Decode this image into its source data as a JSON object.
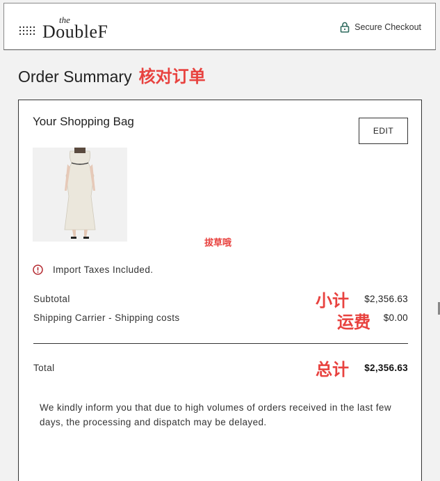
{
  "header": {
    "logo_small": "the",
    "logo_name": "DoubleF",
    "secure_label": "Secure Checkout"
  },
  "page": {
    "title": "Order Summary",
    "title_annotation": "核对订单"
  },
  "bag": {
    "title": "Your Shopping Bag",
    "edit_label": "EDIT",
    "center_annotation": "拔草哦",
    "taxes_notice": "Import Taxes Included.",
    "rows": [
      {
        "label": "Subtotal",
        "value": "$2,356.63",
        "annotation": "小计"
      },
      {
        "label": "Shipping Carrier - Shipping costs",
        "value": "$0.00",
        "annotation": "运费"
      }
    ],
    "total": {
      "label": "Total",
      "value": "$2,356.63",
      "annotation": "总计"
    },
    "delay_notice": "We kindly inform you that due to high volumes of orders received in the last few days, the processing and dispatch may be delayed."
  },
  "colors": {
    "annotation": "#e8423f",
    "lock": "#2e6b5e",
    "warning": "#b3262d"
  },
  "icons": [
    "menu-grid-icon",
    "lock-icon",
    "warning-icon"
  ]
}
